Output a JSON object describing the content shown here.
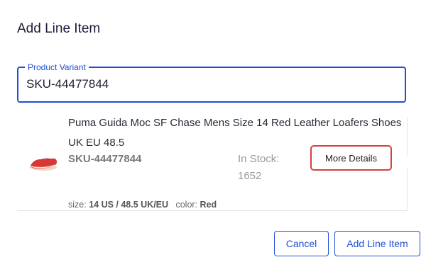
{
  "dialog": {
    "title": "Add Line Item"
  },
  "product_field": {
    "label": "Product Variant",
    "value": "SKU-44477844"
  },
  "result": {
    "product_name": "Puma Guida Moc SF Chase Mens Size 14 Red Leather Loafers Shoes UK EU 48.5",
    "sku": "SKU-44477844",
    "stock_label": "In Stock:",
    "stock_value": "1652",
    "more_details_label": "More Details",
    "size_label": "size:",
    "size_value": "14 US / 48.5 UK/EU",
    "color_label": "color:",
    "color_value": "Red",
    "thumbnail_icon": "red-loafer-shoe-icon"
  },
  "actions": {
    "cancel_label": "Cancel",
    "add_label": "Add Line Item"
  },
  "colors": {
    "accent": "#1f4fd1",
    "highlight": "#d43f3f"
  }
}
